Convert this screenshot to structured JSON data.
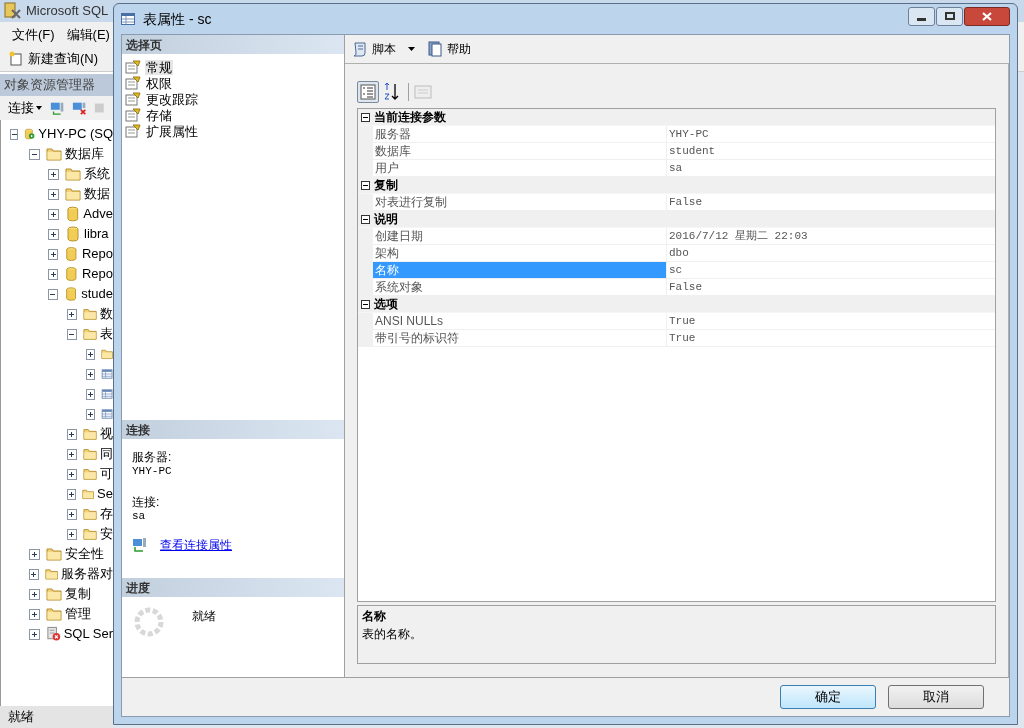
{
  "app": {
    "title": "Microsoft SQL",
    "menu": [
      {
        "label": "文件(F)"
      },
      {
        "label": "编辑(E)"
      }
    ],
    "toolbar": {
      "new_query": "新建查询(N)"
    },
    "explorer": {
      "title": "对象资源管理器",
      "connect": "连接",
      "tree": [
        {
          "kind": "server",
          "label": "YHY-PC (SQ",
          "expanded": true,
          "children": [
            {
              "kind": "folder",
              "label": "数据库",
              "expanded": true,
              "children": [
                {
                  "kind": "folder",
                  "label": "系统",
                  "expanded": false
                },
                {
                  "kind": "folder",
                  "label": "数据",
                  "expanded": false
                },
                {
                  "kind": "database",
                  "label": "Adve",
                  "expanded": false
                },
                {
                  "kind": "database",
                  "label": "libra",
                  "expanded": false
                },
                {
                  "kind": "database",
                  "label": "Repo",
                  "expanded": false
                },
                {
                  "kind": "database",
                  "label": "Repo",
                  "expanded": false
                },
                {
                  "kind": "database",
                  "label": "stude",
                  "expanded": true,
                  "children": [
                    {
                      "kind": "folder",
                      "label": "数",
                      "expanded": false
                    },
                    {
                      "kind": "folder",
                      "label": "表",
                      "expanded": true,
                      "children": [
                        {
                          "kind": "folder",
                          "expanded": false
                        },
                        {
                          "kind": "table",
                          "expanded": false
                        },
                        {
                          "kind": "table",
                          "expanded": false
                        },
                        {
                          "kind": "table",
                          "expanded": false
                        }
                      ]
                    },
                    {
                      "kind": "folder",
                      "label": "视",
                      "expanded": false
                    },
                    {
                      "kind": "folder",
                      "label": "同",
                      "expanded": false
                    },
                    {
                      "kind": "folder",
                      "label": "可",
                      "expanded": false
                    },
                    {
                      "kind": "folder",
                      "label": "Se",
                      "expanded": false
                    },
                    {
                      "kind": "folder",
                      "label": "存",
                      "expanded": false
                    },
                    {
                      "kind": "folder",
                      "label": "安",
                      "expanded": false
                    }
                  ]
                }
              ]
            },
            {
              "kind": "folder",
              "label": "安全性",
              "expanded": false
            },
            {
              "kind": "folder",
              "label": "服务器对",
              "expanded": false
            },
            {
              "kind": "folder",
              "label": "复制",
              "expanded": false
            },
            {
              "kind": "folder",
              "label": "管理",
              "expanded": false
            },
            {
              "kind": "agent",
              "label": "SQL Ser",
              "expanded": false
            }
          ]
        }
      ]
    },
    "status_bar": "就绪"
  },
  "dialog": {
    "title": "表属性 - sc",
    "select_page": {
      "title": "选择页",
      "items": [
        {
          "label": "常规",
          "selected": true
        },
        {
          "label": "权限",
          "selected": false
        },
        {
          "label": "更改跟踪",
          "selected": false
        },
        {
          "label": "存储",
          "selected": false
        },
        {
          "label": "扩展属性",
          "selected": false
        }
      ]
    },
    "connection": {
      "title": "连接",
      "server_label": "服务器:",
      "server": "YHY-PC",
      "connection_label": "连接:",
      "connection": "sa",
      "link": "查看连接属性"
    },
    "progress": {
      "title": "进度",
      "status": "就绪"
    },
    "toolbar": {
      "script": "脚本",
      "help": "帮助"
    },
    "sort_buttons": [
      {
        "kind": "categorized",
        "selected": true
      },
      {
        "kind": "alphabetical",
        "selected": false
      }
    ],
    "properties": [
      {
        "category": "当前连接参数",
        "expanded": true,
        "rows": [
          {
            "name": "服务器",
            "value": "YHY-PC",
            "selected": false
          },
          {
            "name": "数据库",
            "value": "student",
            "selected": false
          },
          {
            "name": "用户",
            "value": "sa",
            "selected": false
          }
        ]
      },
      {
        "category": "复制",
        "expanded": true,
        "rows": [
          {
            "name": "对表进行复制",
            "value": "False",
            "selected": false
          }
        ]
      },
      {
        "category": "说明",
        "expanded": true,
        "rows": [
          {
            "name": "创建日期",
            "value": "2016/7/12 星期二 22:03",
            "selected": false
          },
          {
            "name": "架构",
            "value": "dbo",
            "selected": false
          },
          {
            "name": "名称",
            "value": "sc",
            "selected": true
          },
          {
            "name": "系统对象",
            "value": "False",
            "selected": false
          }
        ]
      },
      {
        "category": "选项",
        "expanded": true,
        "rows": [
          {
            "name": "ANSI NULLs",
            "value": "True",
            "selected": false
          },
          {
            "name": "带引号的标识符",
            "value": "True",
            "selected": false
          }
        ]
      }
    ],
    "description": {
      "title": "名称",
      "text": "表的名称。"
    },
    "buttons": [
      {
        "label": "确定",
        "default": true
      },
      {
        "label": "取消",
        "default": false
      }
    ]
  }
}
